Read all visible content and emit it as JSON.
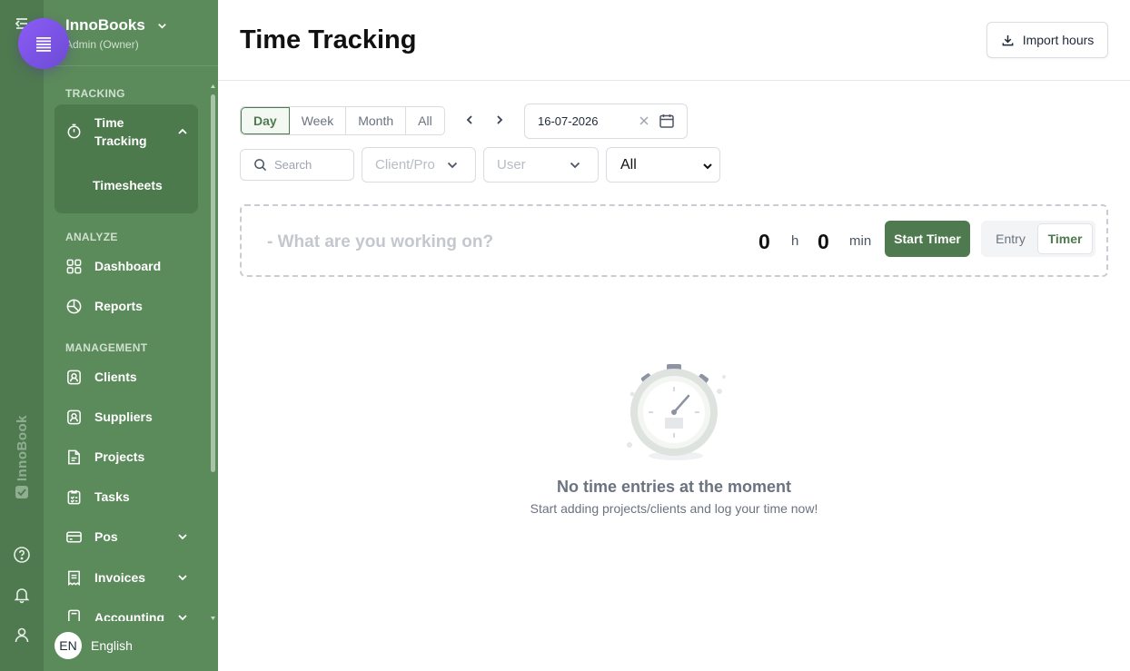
{
  "app": {
    "org_name": "InnoBooks",
    "org_role": "Admin (Owner)",
    "rail_brand": "InnoBook"
  },
  "sidebar": {
    "sections": {
      "tracking": "TRACKING",
      "analyze": "ANALYZE",
      "management": "MANAGEMENT"
    },
    "items": {
      "time_tracking": "Time Tracking",
      "timesheets": "Timesheets",
      "dashboard": "Dashboard",
      "reports": "Reports",
      "clients": "Clients",
      "suppliers": "Suppliers",
      "projects": "Projects",
      "tasks": "Tasks",
      "pos": "Pos",
      "invoices": "Invoices",
      "accounting": "Accounting"
    },
    "language": {
      "code": "EN",
      "label": "English"
    }
  },
  "header": {
    "title": "Time Tracking",
    "import_label": "Import hours"
  },
  "filters": {
    "periods": [
      "Day",
      "Week",
      "Month",
      "All"
    ],
    "active_period": "Day",
    "date_value": "16-07-2026",
    "search_placeholder": "Search",
    "client_placeholder": "Client/Pro",
    "user_placeholder": "User",
    "status_value": "All"
  },
  "timer": {
    "placeholder": "- What are you working on?",
    "hours": "0",
    "hours_unit": "h",
    "minutes": "0",
    "minutes_unit": "min",
    "start_label": "Start Timer",
    "modes": [
      "Entry",
      "Timer"
    ],
    "active_mode": "Timer"
  },
  "empty_state": {
    "title": "No time entries at the moment",
    "subtitle": "Start adding projects/clients and log your time now!"
  },
  "colors": {
    "sidebar_bg": "#5b8a5b",
    "rail_bg": "#4f7a4f",
    "accent": "#4f7a4f",
    "fab": "#7c55e0"
  }
}
